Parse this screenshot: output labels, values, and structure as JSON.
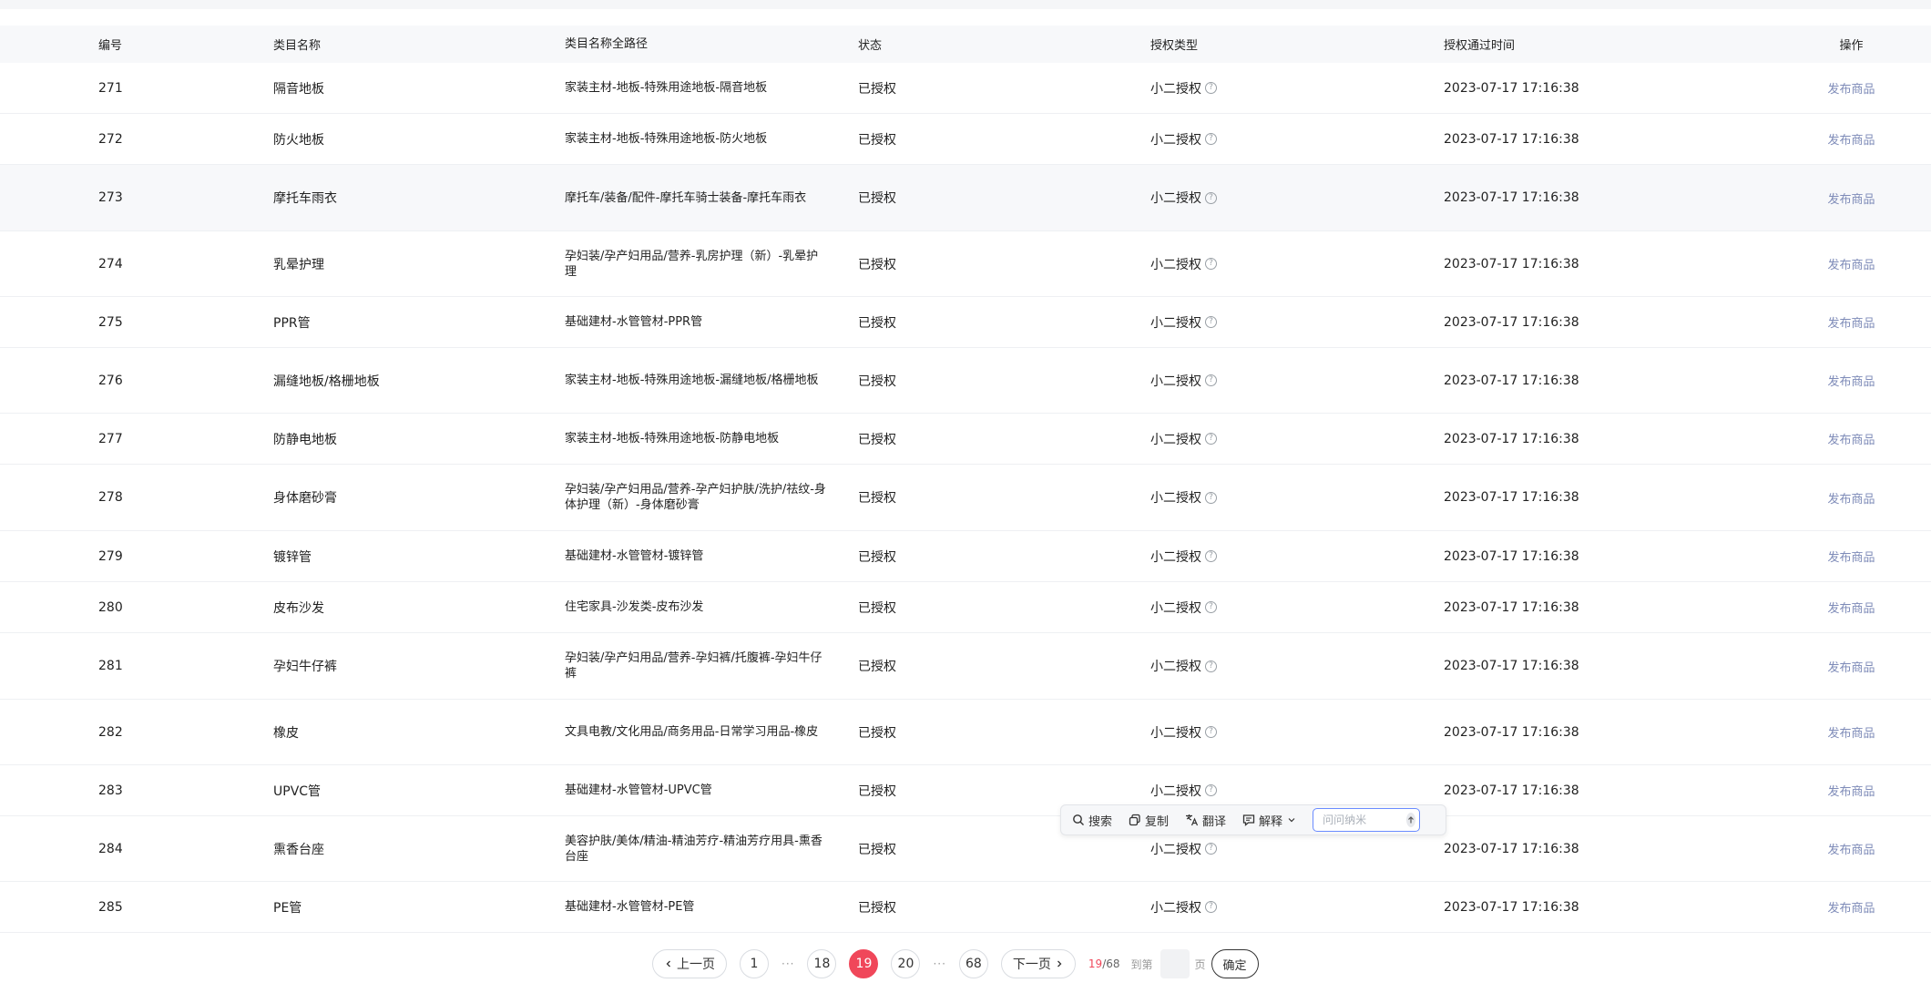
{
  "table": {
    "columns": {
      "id": "编号",
      "name": "类目名称",
      "path": "类目名称全路径",
      "status": "状态",
      "auth_type": "授权类型",
      "auth_time": "授权通过时间",
      "op": "操作"
    },
    "rows": [
      {
        "id": "271",
        "name": "隔音地板",
        "path": "家装主材-地板-特殊用途地板-隔音地板",
        "status": "已授权",
        "auth_type": "小二授权",
        "auth_time": "2023-07-17 17:16:38",
        "op": "发布商品"
      },
      {
        "id": "272",
        "name": "防火地板",
        "path": "家装主材-地板-特殊用途地板-防火地板",
        "status": "已授权",
        "auth_type": "小二授权",
        "auth_time": "2023-07-17 17:16:38",
        "op": "发布商品"
      },
      {
        "id": "273",
        "name": "摩托车雨衣",
        "path": "摩托车/装备/配件-摩托车骑士装备-摩托车雨衣",
        "status": "已授权",
        "auth_type": "小二授权",
        "auth_time": "2023-07-17 17:16:38",
        "op": "发布商品"
      },
      {
        "id": "274",
        "name": "乳晕护理",
        "path": "孕妇装/孕产妇用品/营养-乳房护理（新）-乳晕护理",
        "status": "已授权",
        "auth_type": "小二授权",
        "auth_time": "2023-07-17 17:16:38",
        "op": "发布商品"
      },
      {
        "id": "275",
        "name": "PPR管",
        "path": "基础建材-水管管材-PPR管",
        "status": "已授权",
        "auth_type": "小二授权",
        "auth_time": "2023-07-17 17:16:38",
        "op": "发布商品"
      },
      {
        "id": "276",
        "name": "漏缝地板/格栅地板",
        "path": "家装主材-地板-特殊用途地板-漏缝地板/格栅地板",
        "status": "已授权",
        "auth_type": "小二授权",
        "auth_time": "2023-07-17 17:16:38",
        "op": "发布商品"
      },
      {
        "id": "277",
        "name": "防静电地板",
        "path": "家装主材-地板-特殊用途地板-防静电地板",
        "status": "已授权",
        "auth_type": "小二授权",
        "auth_time": "2023-07-17 17:16:38",
        "op": "发布商品"
      },
      {
        "id": "278",
        "name": "身体磨砂膏",
        "path": "孕妇装/孕产妇用品/营养-孕产妇护肤/洗护/祛纹-身体护理（新）-身体磨砂膏",
        "status": "已授权",
        "auth_type": "小二授权",
        "auth_time": "2023-07-17 17:16:38",
        "op": "发布商品"
      },
      {
        "id": "279",
        "name": "镀锌管",
        "path": "基础建材-水管管材-镀锌管",
        "status": "已授权",
        "auth_type": "小二授权",
        "auth_time": "2023-07-17 17:16:38",
        "op": "发布商品"
      },
      {
        "id": "280",
        "name": "皮布沙发",
        "path": "住宅家具-沙发类-皮布沙发",
        "status": "已授权",
        "auth_type": "小二授权",
        "auth_time": "2023-07-17 17:16:38",
        "op": "发布商品"
      },
      {
        "id": "281",
        "name": "孕妇牛仔裤",
        "path": "孕妇装/孕产妇用品/营养-孕妇裤/托腹裤-孕妇牛仔裤",
        "status": "已授权",
        "auth_type": "小二授权",
        "auth_time": "2023-07-17 17:16:38",
        "op": "发布商品"
      },
      {
        "id": "282",
        "name": "橡皮",
        "path": "文具电教/文化用品/商务用品-日常学习用品-橡皮",
        "status": "已授权",
        "auth_type": "小二授权",
        "auth_time": "2023-07-17 17:16:38",
        "op": "发布商品"
      },
      {
        "id": "283",
        "name": "UPVC管",
        "path": "基础建材-水管管材-UPVC管",
        "status": "已授权",
        "auth_type": "小二授权",
        "auth_time": "2023-07-17 17:16:38",
        "op": "发布商品"
      },
      {
        "id": "284",
        "name": "熏香台座",
        "path": "美容护肤/美体/精油-精油芳疗-精油芳疗用具-熏香台座",
        "status": "已授权",
        "auth_type": "小二授权",
        "auth_time": "2023-07-17 17:16:38",
        "op": "发布商品"
      },
      {
        "id": "285",
        "name": "PE管",
        "path": "基础建材-水管管材-PE管",
        "status": "已授权",
        "auth_type": "小二授权",
        "auth_time": "2023-07-17 17:16:38",
        "op": "发布商品"
      }
    ]
  },
  "toolbar": {
    "search": "搜索",
    "copy": "复制",
    "translate": "翻译",
    "explain": "解释",
    "ask_placeholder": "问问纳米"
  },
  "pagination": {
    "prev": "上一页",
    "next": "下一页",
    "pages": [
      "1",
      "18",
      "19",
      "20",
      "68"
    ],
    "current": "19",
    "total": "68",
    "separator": "/",
    "ellipsis": "···",
    "goto_label": "到第",
    "goto_unit": "页",
    "confirm": "确定"
  }
}
